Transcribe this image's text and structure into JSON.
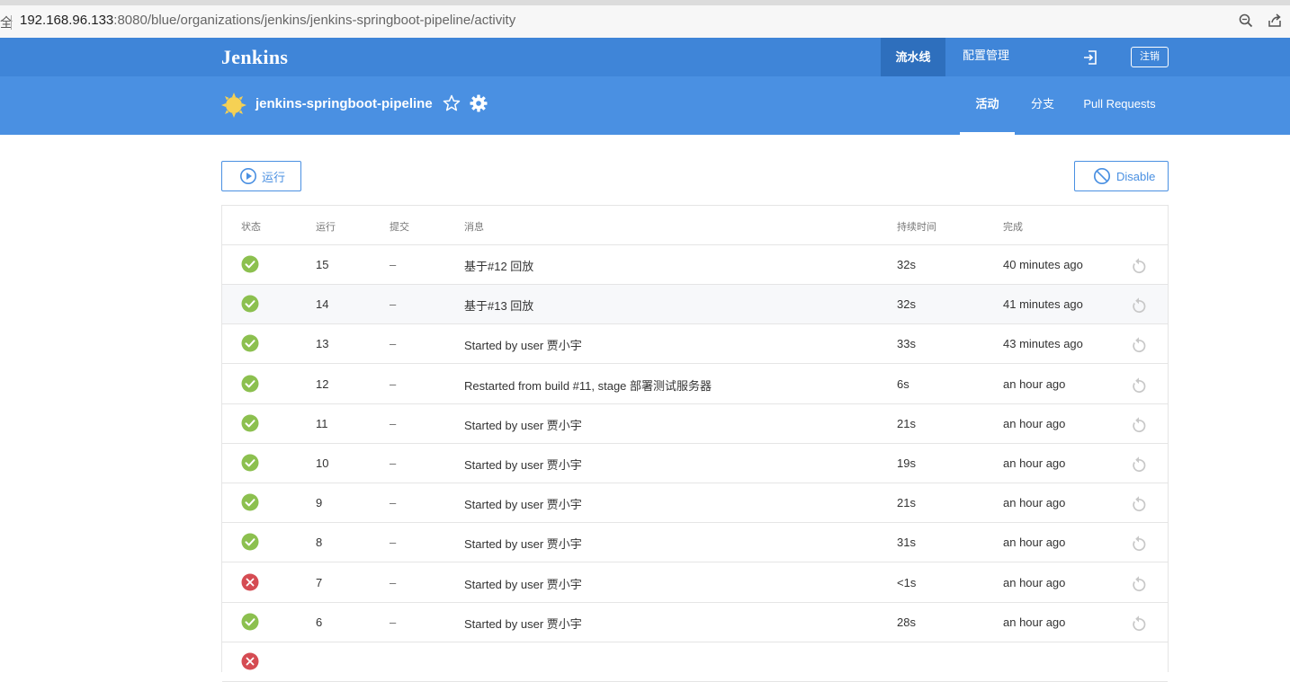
{
  "browser": {
    "url_host": "192.168.96.133",
    "url_rest": ":8080/blue/organizations/jenkins/jenkins-springboot-pipeline/activity",
    "edge_glyph": "全"
  },
  "topnav": {
    "logo": "Jenkins",
    "pipelines": "流水线",
    "admin": "配置管理",
    "logout": "注销"
  },
  "pipeline": {
    "name": "jenkins-springboot-pipeline",
    "tabs": {
      "activity": "活动",
      "branches": "分支",
      "pull_requests": "Pull Requests"
    }
  },
  "actions": {
    "run": "运行",
    "disable": "Disable"
  },
  "table": {
    "headers": {
      "status": "状态",
      "run": "运行",
      "commit": "提交",
      "message": "消息",
      "duration": "持续时间",
      "completed": "完成"
    },
    "rows": [
      {
        "status": "success",
        "run": "15",
        "commit": "–",
        "message": "基于#12 回放",
        "duration": "32s",
        "completed": "40 minutes ago"
      },
      {
        "status": "success",
        "run": "14",
        "commit": "–",
        "message": "基于#13 回放",
        "duration": "32s",
        "completed": "41 minutes ago"
      },
      {
        "status": "success",
        "run": "13",
        "commit": "–",
        "message": "Started by user 贾小宇",
        "duration": "33s",
        "completed": "43 minutes ago"
      },
      {
        "status": "success",
        "run": "12",
        "commit": "–",
        "message": "Restarted from build #11, stage 部署测试服务器",
        "duration": "6s",
        "completed": "an hour ago"
      },
      {
        "status": "success",
        "run": "11",
        "commit": "–",
        "message": "Started by user 贾小宇",
        "duration": "21s",
        "completed": "an hour ago"
      },
      {
        "status": "success",
        "run": "10",
        "commit": "–",
        "message": "Started by user 贾小宇",
        "duration": "19s",
        "completed": "an hour ago"
      },
      {
        "status": "success",
        "run": "9",
        "commit": "–",
        "message": "Started by user 贾小宇",
        "duration": "21s",
        "completed": "an hour ago"
      },
      {
        "status": "success",
        "run": "8",
        "commit": "–",
        "message": "Started by user 贾小宇",
        "duration": "31s",
        "completed": "an hour ago"
      },
      {
        "status": "failure",
        "run": "7",
        "commit": "–",
        "message": "Started by user 贾小宇",
        "duration": "<1s",
        "completed": "an hour ago"
      },
      {
        "status": "success",
        "run": "6",
        "commit": "–",
        "message": "Started by user 贾小宇",
        "duration": "28s",
        "completed": "an hour ago"
      },
      {
        "status": "failure",
        "run": "",
        "commit": "",
        "message": "",
        "duration": "",
        "completed": ""
      }
    ]
  },
  "colors": {
    "topnav": "#3f85d8",
    "header": "#4a90e2",
    "success": "#8cc04f",
    "failure": "#d54c53",
    "accent": "#4a90e2"
  }
}
